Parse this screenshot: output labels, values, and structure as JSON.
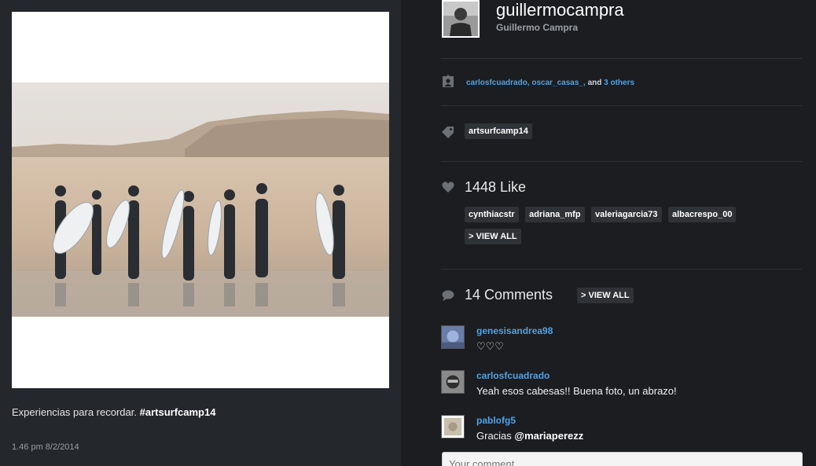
{
  "post": {
    "caption_text": "Experiencias para recordar.",
    "caption_hashtag": "#artsurfcamp14",
    "timestamp": "1.46 pm 8/2/2014"
  },
  "author": {
    "username": "guillermocampra",
    "full_name": "Guillermo Campra"
  },
  "tagged": {
    "user1": "carlosfcuadrado,",
    "user2": "oscar_casas_,",
    "and_text": "and",
    "others": "3 others"
  },
  "hashtag": "artsurfcamp14",
  "likes": {
    "count_text": "1448 Like",
    "users": [
      "cynthiacstr",
      "adriana_mfp",
      "valeriagarcia73",
      "albacrespo_00"
    ],
    "view_all": "> VIEW ALL"
  },
  "comments": {
    "count_text": "14 Comments",
    "view_all": "> VIEW ALL",
    "items": [
      {
        "user": "genesisandrea98",
        "text": "♡♡♡"
      },
      {
        "user": "carlosfcuadrado",
        "text": "Yeah esos cabesas!! Buena foto, un abrazo!"
      },
      {
        "user": "pablofg5",
        "text_prefix": "Gracias ",
        "mention": "@mariaperezz"
      }
    ],
    "input_placeholder": "Your comment"
  },
  "colors": {
    "link_blue": "#4ea3e8",
    "panel_left": "#24272b",
    "panel_right": "#1b1d20",
    "chip_bg": "#2f3236"
  },
  "icons": [
    "person-tag-icon",
    "tag-icon",
    "heart-icon",
    "speech-bubble-icon"
  ]
}
